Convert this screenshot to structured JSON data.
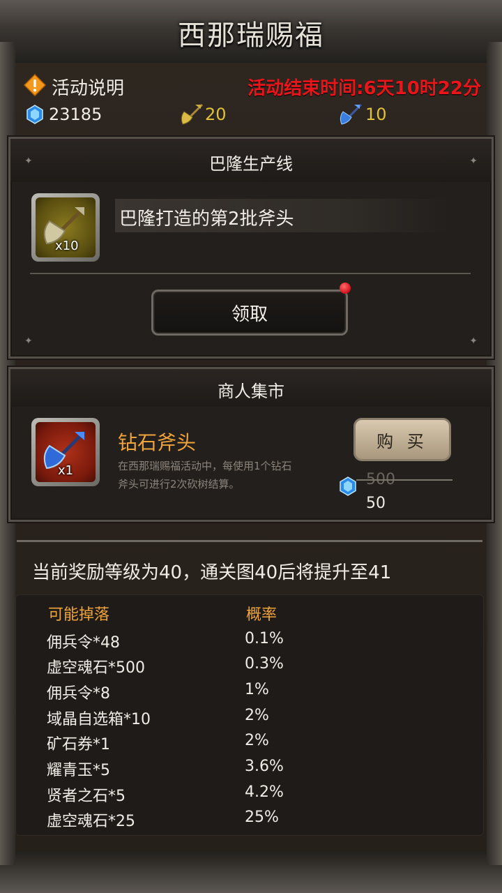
{
  "title": "西那瑞赐福",
  "header": {
    "activity_desc": "活动说明",
    "end_time": "活动结束时间:6天10时22分",
    "currency": {
      "gems": "23185",
      "gold_axe": "20",
      "diamond_axe": "10"
    }
  },
  "production": {
    "title": "巴隆生产线",
    "item_name": "巴隆打造的第2批斧头",
    "item_count": "x10",
    "claim_label": "领取"
  },
  "market": {
    "title": "商人集市",
    "item_name": "钻石斧头",
    "item_desc_line1": "在西那瑞赐福活动中，每使用1个钻石",
    "item_desc_line2": "斧头可进行2次砍树结算。",
    "item_count": "x1",
    "buy_label": "购 买",
    "old_price": "500",
    "price": "50"
  },
  "reward": {
    "text": "当前奖励等级为40，通关图40后将提升至41",
    "col_drop": "可能掉落",
    "col_rate": "概率",
    "rows": [
      {
        "item": "佣兵令*48",
        "rate": "0.1%"
      },
      {
        "item": "虚空魂石*500",
        "rate": "0.3%"
      },
      {
        "item": "佣兵令*8",
        "rate": "1%"
      },
      {
        "item": "域晶自选箱*10",
        "rate": "2%"
      },
      {
        "item": "矿石券*1",
        "rate": "2%"
      },
      {
        "item": "耀青玉*5",
        "rate": "3.6%"
      },
      {
        "item": "贤者之石*5",
        "rate": "4.2%"
      },
      {
        "item": "虚空魂石*25",
        "rate": "25%"
      }
    ]
  },
  "colors": {
    "accent_orange": "#f0a43a",
    "end_time_red": "#e8161a",
    "gold": "#e0c13a",
    "gem_blue": "#3ab4ff"
  }
}
